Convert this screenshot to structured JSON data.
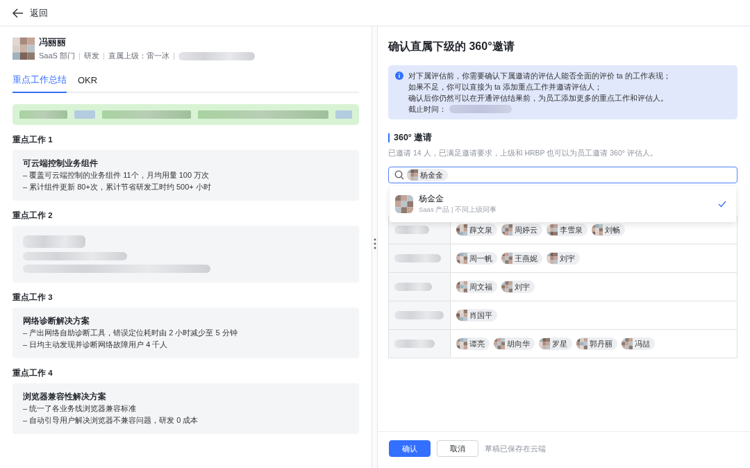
{
  "header": {
    "back_label": "返回"
  },
  "profile": {
    "name": "冯丽丽",
    "meta": [
      "SaaS 部门",
      "研发",
      "直属上级：雷一冰"
    ]
  },
  "tabs": [
    {
      "label": "重点工作总结",
      "selected": true
    },
    {
      "label": "OKR",
      "selected": false
    }
  ],
  "work_items": [
    {
      "title": "重点工作 1",
      "kind": "text",
      "heading": "可云端控制业务组件",
      "lines": [
        "– 覆盖可云端控制的业务组件 11个，月均用量 100 万次",
        "– 累计组件更新 80+次，累计节省研发工时约 500+ 小时"
      ]
    },
    {
      "title": "重点工作 2",
      "kind": "redacted"
    },
    {
      "title": "重点工作 3",
      "kind": "text",
      "heading": "网络诊断解决方案",
      "lines": [
        "– 产出网络自助诊断工具，错误定位耗时由 2 小时减少至 5 分钟",
        "– 日均主动发现并诊断网络故障用户 4 千人"
      ]
    },
    {
      "title": "重点工作 4",
      "kind": "text",
      "heading": "浏览器兼容性解决方案",
      "lines": [
        "– 统一了各业务线浏览器兼容标准",
        "– 自动引导用户解决浏览器不兼容问题，研发 0 成本"
      ]
    }
  ],
  "panel": {
    "title": "确认直属下级的 360°邀请",
    "notice": [
      "对下属评估前，你需要确认下属邀请的评估人能否全面的评价 ta 的工作表现；",
      "如果不足，你可以直接为 ta 添加重点工作并邀请评估人；",
      "确认后你仍然可以在开通评估结果前，为员工添加更多的重点工作和评估人。"
    ],
    "deadline_label": "截止时间：",
    "section_title": "360° 邀请",
    "section_desc": "已邀请 14 人，已满足邀请要求，上级和 HRBP 也可以为员工邀请 360° 评估人。",
    "search_chips": [
      "杨金金"
    ],
    "option": {
      "name": "杨金金",
      "detail": "Saas 产品 | 不同上级同事",
      "selected": true
    },
    "invite_rows": [
      {
        "people": [
          "薛文泉",
          "周婷云",
          "李雪泉",
          "刘畅"
        ]
      },
      {
        "people": [
          "周一帆",
          "王燕妮",
          "刘宇"
        ]
      },
      {
        "people": [
          "周文福",
          "刘宇"
        ]
      },
      {
        "people": [
          "肖国平"
        ]
      },
      {
        "people": [
          "谭亮",
          "胡向华",
          "罗星",
          "郭丹丽",
          "冯喆"
        ]
      }
    ]
  },
  "footer": {
    "confirm": "确认",
    "cancel": "取消",
    "note": "草稿已保存在云端"
  }
}
